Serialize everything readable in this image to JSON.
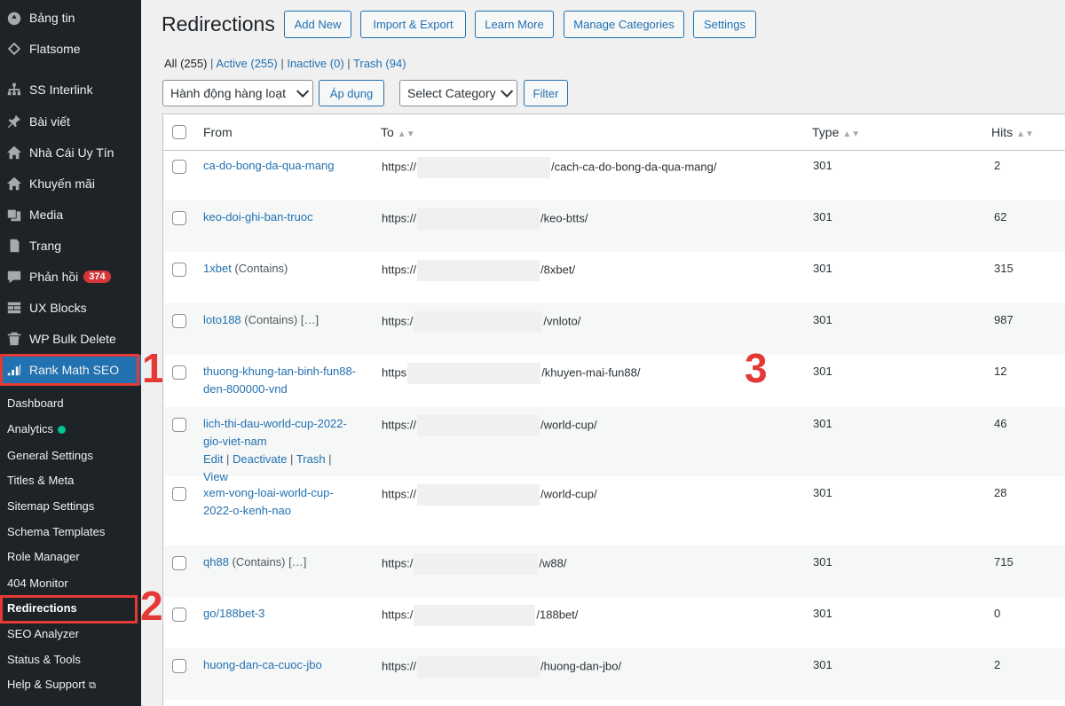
{
  "sidebar": {
    "items": [
      {
        "label": "Bảng tin",
        "icon": "dashboard-icon"
      },
      {
        "label": "Flatsome",
        "icon": "diamond-icon"
      },
      {
        "label": "SS Interlink",
        "icon": "sitemap-icon"
      },
      {
        "label": "Bài viết",
        "icon": "pin-icon"
      },
      {
        "label": "Nhà Cái Uy Tín",
        "icon": "home-icon"
      },
      {
        "label": "Khuyến mãi",
        "icon": "home-icon"
      },
      {
        "label": "Media",
        "icon": "media-icon"
      },
      {
        "label": "Trang",
        "icon": "page-icon"
      },
      {
        "label": "Phản hồi",
        "icon": "comment-icon",
        "badge": "374"
      },
      {
        "label": "UX Blocks",
        "icon": "blocks-icon"
      },
      {
        "label": "WP Bulk Delete",
        "icon": "trash-icon"
      },
      {
        "label": "Rank Math SEO",
        "icon": "rankmath-icon",
        "active": true
      }
    ],
    "submenu": [
      {
        "label": "Dashboard"
      },
      {
        "label": "Analytics",
        "dot": true
      },
      {
        "label": "General Settings"
      },
      {
        "label": "Titles & Meta"
      },
      {
        "label": "Sitemap Settings"
      },
      {
        "label": "Schema Templates"
      },
      {
        "label": "Role Manager"
      },
      {
        "label": "404 Monitor"
      },
      {
        "label": "Redirections",
        "current": true
      },
      {
        "label": "SEO Analyzer"
      },
      {
        "label": "Status & Tools"
      },
      {
        "label": "Help & Support",
        "external": true
      }
    ]
  },
  "annotations": [
    "1",
    "2",
    "3"
  ],
  "header": {
    "title": "Redirections",
    "buttons": [
      "Add New",
      "Import & Export",
      "Learn More",
      "Manage Categories",
      "Settings"
    ]
  },
  "filters": {
    "all": "All",
    "all_count": "(255)",
    "active": "Active",
    "active_count": "(255)",
    "inactive": "Inactive",
    "inactive_count": "(0)",
    "trash": "Trash",
    "trash_count": "(94)"
  },
  "toolbar": {
    "bulk_action": "Hành động hàng loạt",
    "apply": "Áp dụng",
    "category": "Select Category",
    "filter": "Filter"
  },
  "table": {
    "columns": [
      "From",
      "To",
      "Type",
      "Hits"
    ],
    "rows": [
      {
        "from": "ca-do-bong-da-qua-mang",
        "note": "",
        "to_prefix": "https://",
        "to_suffix": "/cach-ca-do-bong-da-qua-mang/",
        "type": "301",
        "hits": "2"
      },
      {
        "from": "keo-doi-ghi-ban-truoc",
        "note": "",
        "to_prefix": "https://",
        "to_suffix": "/keo-btts/",
        "type": "301",
        "hits": "62"
      },
      {
        "from": "1xbet",
        "note": " (Contains)",
        "to_prefix": "https://",
        "to_suffix": "/8xbet/",
        "type": "301",
        "hits": "315"
      },
      {
        "from": "loto188",
        "note": " (Contains) […]",
        "to_prefix": "https:/",
        "to_suffix": "/vnloto/",
        "type": "301",
        "hits": "987"
      },
      {
        "from": "thuong-khung-tan-binh-fun88-den-800000-vnd",
        "note": "",
        "to_prefix": "https",
        "to_suffix": "/khuyen-mai-fun88/",
        "type": "301",
        "hits": "12"
      },
      {
        "from": "lich-thi-dau-world-cup-2022-gio-viet-nam",
        "note": "",
        "to_prefix": "https://",
        "to_suffix": "/world-cup/",
        "type": "301",
        "hits": "46",
        "actions": [
          "Edit",
          "Deactivate",
          "Trash",
          "View"
        ]
      },
      {
        "from": "xem-vong-loai-world-cup-2022-o-kenh-nao",
        "note": "",
        "to_prefix": "https://",
        "to_suffix": "/world-cup/",
        "type": "301",
        "hits": "28"
      },
      {
        "from": "qh88",
        "note": " (Contains) […]",
        "to_prefix": "https:/",
        "to_suffix": "/w88/",
        "type": "301",
        "hits": "715"
      },
      {
        "from": "go/188bet-3",
        "note": "",
        "to_prefix": "https:/",
        "to_suffix": "/188bet/",
        "type": "301",
        "hits": "0"
      },
      {
        "from": "huong-dan-ca-cuoc-jbo",
        "note": "",
        "to_prefix": "https://",
        "to_suffix": "/huong-dan-jbo/",
        "type": "301",
        "hits": "2"
      }
    ]
  }
}
